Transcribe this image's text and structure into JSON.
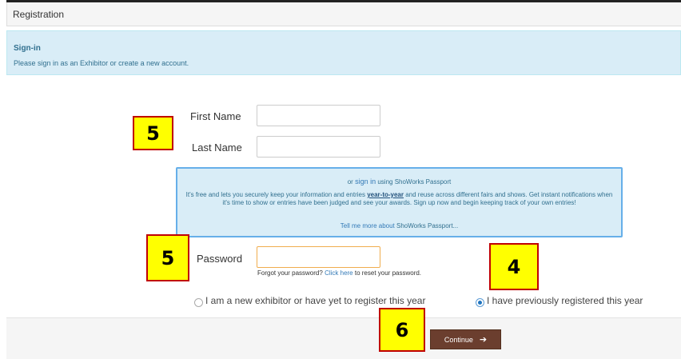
{
  "panel": {
    "title": "Registration"
  },
  "signin": {
    "title": "Sign-in",
    "description": "Please sign in as an Exhibitor or create a new account."
  },
  "form": {
    "first_name_label": "First Name",
    "first_name_value": "",
    "last_name_label": "Last Name",
    "last_name_value": "",
    "password_label": "Password",
    "password_value": "",
    "forgot_prefix": "Forgot your password?",
    "forgot_link": "Click here",
    "forgot_suffix": "to reset your password."
  },
  "passport": {
    "or_text": "or",
    "signin_link": "sign in",
    "using_text": "using ShoWorks Passport",
    "body_prefix": "It's free and lets you securely keep your information and entries",
    "body_link": "year-to-year",
    "body_suffix": "and reuse across different fairs and shows. Get instant notifications when it's time to show or entries have been judged and see your awards. Sign up now and begin keeping track of your own entries!",
    "more_link": "Tell me more about",
    "more_suffix": "ShoWorks Passport..."
  },
  "options": {
    "new_exhibitor": "I am a new exhibitor or have yet to register this year",
    "previous": "I have previously registered this year",
    "selected": "previous"
  },
  "actions": {
    "continue_label": "Continue",
    "continue_icon": "arrow-right-icon"
  },
  "callouts": {
    "name_fields": "5",
    "password": "5",
    "previous_option": "4",
    "continue": "6"
  },
  "colors": {
    "info_bg": "#d9edf7",
    "continue_bg": "#6b3e2e",
    "callout_bg": "#ffff00",
    "callout_border": "#c00000"
  }
}
